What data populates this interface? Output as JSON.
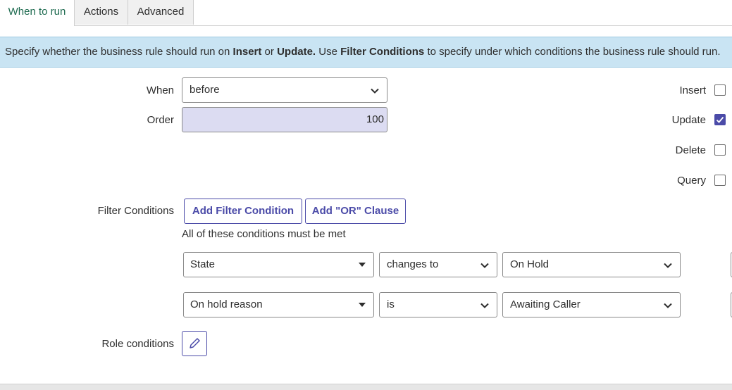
{
  "tabs": [
    {
      "label": "When to run",
      "active": true
    },
    {
      "label": "Actions",
      "active": false
    },
    {
      "label": "Advanced",
      "active": false
    }
  ],
  "info": {
    "p1": "Specify whether the business rule should run on ",
    "b1": "Insert",
    "p2": " or ",
    "b2": "Update.",
    "p3": " Use ",
    "b3": "Filter Conditions",
    "p4": " to specify under which conditions the business rule should run."
  },
  "form": {
    "when_label": "When",
    "when_value": "before",
    "order_label": "Order",
    "order_value": "100",
    "filter_label": "Filter Conditions",
    "role_label": "Role conditions"
  },
  "checkboxes": [
    {
      "label": "Insert",
      "checked": false
    },
    {
      "label": "Update",
      "checked": true
    },
    {
      "label": "Delete",
      "checked": false
    },
    {
      "label": "Query",
      "checked": false
    }
  ],
  "buttons": {
    "add_filter": "Add Filter Condition",
    "add_or": "Add \"OR\" Clause"
  },
  "conditions_hint": "All of these conditions must be met",
  "conditions": [
    {
      "field": "State",
      "operator": "changes to",
      "value": "On Hold"
    },
    {
      "field": "On hold reason",
      "operator": "is",
      "value": "Awaiting Caller"
    }
  ],
  "colors": {
    "accent": "#4b4ba8",
    "info_bg": "#c9e4f3",
    "active_tab_text": "#1e6b50",
    "order_bg": "#dcdcf2"
  },
  "icons": {
    "select_chevron": "chevron-down-icon",
    "field_caret": "caret-down-icon",
    "checkmark": "check-icon",
    "edit": "pencil-icon"
  }
}
